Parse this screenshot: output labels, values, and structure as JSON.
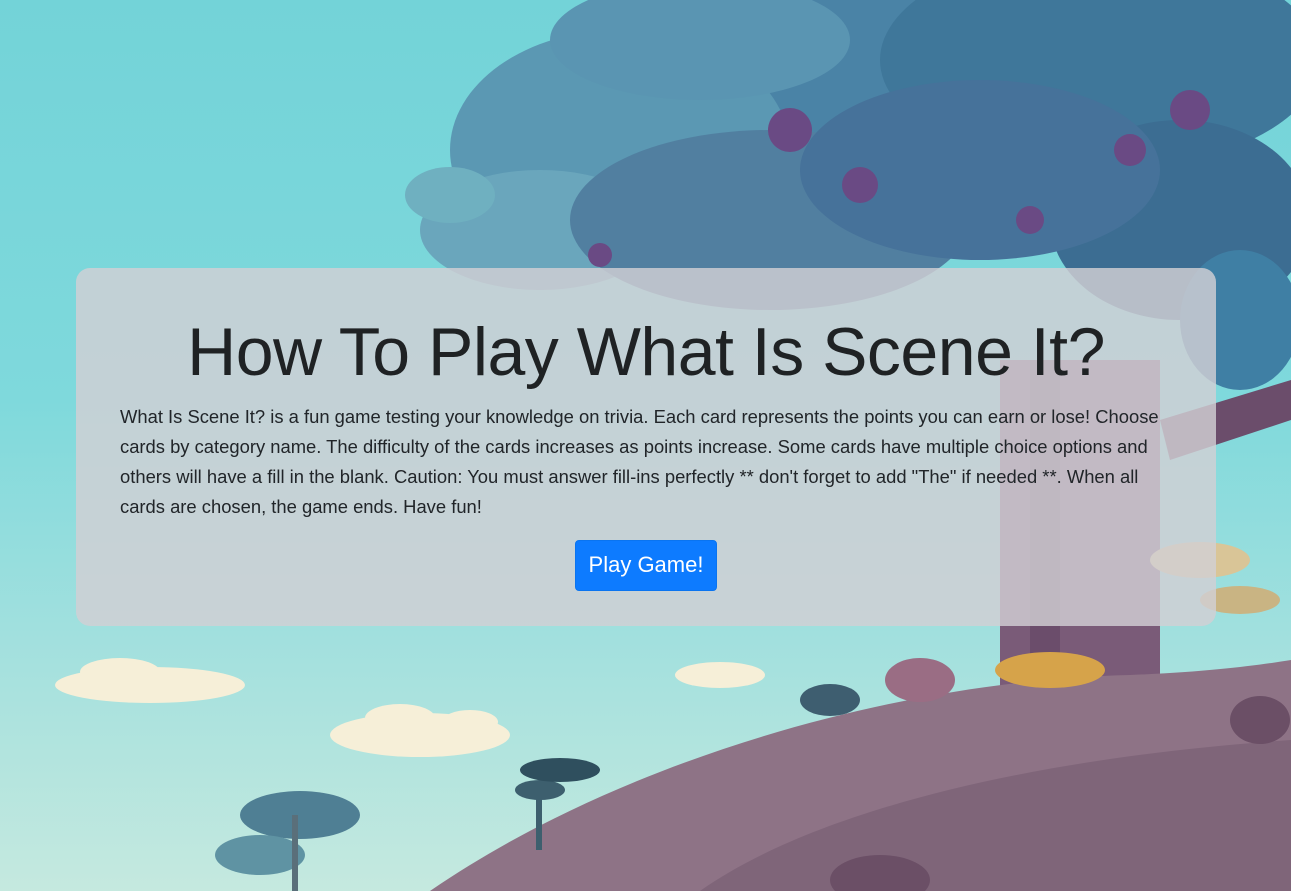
{
  "jumbotron": {
    "title": "How To Play What Is Scene It?",
    "rules": "What Is Scene It? is a fun game testing your knowledge on trivia. Each card represents the points you can earn or lose! Choose cards by category name. The difficulty of the cards increases as points increase. Some cards have multiple choice options and others will have a fill in the blank. Caution: You must answer fill-ins perfectly ** don't forget to add \"The\" if needed **. When all cards are chosen, the game ends. Have fun!",
    "play_button_label": "Play Game!"
  },
  "colors": {
    "sky": "#7fd9dc",
    "tree_canopy": "#4f86a8",
    "hill": "#8e7386",
    "panel": "#d2d0d4",
    "button": "#0d7bff"
  }
}
